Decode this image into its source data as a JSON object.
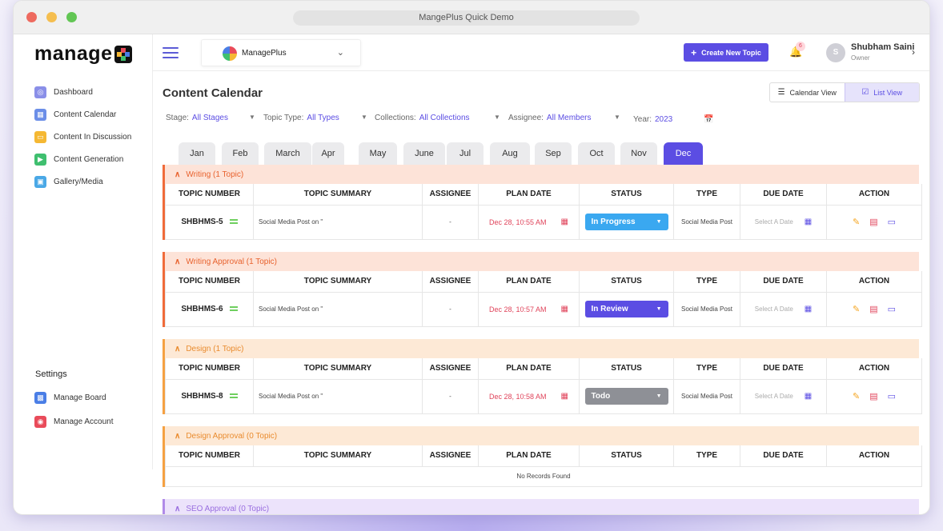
{
  "window_title": "MangePlus Quick Demo",
  "brand": {
    "logo_text": "manage"
  },
  "sidebar": {
    "items": [
      {
        "label": "Dashboard",
        "icon": "dashboard-icon",
        "color": "#8a8fe8"
      },
      {
        "label": "Content Calendar",
        "icon": "calendar-icon",
        "color": "#6b8ee8"
      },
      {
        "label": "Content In Discussion",
        "icon": "chat-icon",
        "color": "#f5b833"
      },
      {
        "label": "Content Generation",
        "icon": "megaphone-icon",
        "color": "#3fbf6f"
      },
      {
        "label": "Gallery/Media",
        "icon": "image-icon",
        "color": "#4aa8e6"
      }
    ],
    "settings_title": "Settings",
    "settings_items": [
      {
        "label": "Manage Board",
        "icon": "board-icon",
        "color": "#4a7ee6"
      },
      {
        "label": "Manage Account",
        "icon": "users-icon",
        "color": "#e94b5a"
      }
    ]
  },
  "topbar": {
    "workspace": "ManagePlus",
    "create_label": "Create New Topic",
    "notification_count": "6",
    "user_initial": "S",
    "user_name": "Shubham Saini",
    "user_role": "Owner"
  },
  "main": {
    "page_title": "Content Calendar",
    "view_calendar": "Calendar View",
    "view_list": "List View",
    "filters": {
      "stage_label": "Stage:",
      "stage_value": "All Stages",
      "type_label": "Topic Type:",
      "type_value": "All Types",
      "collections_label": "Collections:",
      "collections_value": "All Collections",
      "assignee_label": "Assignee:",
      "assignee_value": "All Members",
      "year_label": "Year:",
      "year_value": "2023"
    },
    "months": [
      "Jan",
      "Feb",
      "March",
      "Apr",
      "May",
      "June",
      "Jul",
      "Aug",
      "Sep",
      "Oct",
      "Nov",
      "Dec"
    ],
    "active_month": "Dec",
    "columns": [
      "TOPIC NUMBER",
      "TOPIC SUMMARY",
      "ASSIGNEE",
      "PLAN DATE",
      "STATUS",
      "TYPE",
      "DUE DATE",
      "ACTION"
    ],
    "sections": [
      {
        "title": "Writing (1 Topic)",
        "accent": "#f06b3a",
        "head_bg": "#fde3d8",
        "head_color": "#e8622e",
        "rows": [
          {
            "number": "SHBHMS-5",
            "summary": "Social Media Post on \"",
            "assignee": "-",
            "plan_date": "Dec 28, 10:55 AM",
            "status": "In Progress",
            "status_color": "#3aa8f0",
            "type": "Social Media Post",
            "due": "Select A Date"
          }
        ]
      },
      {
        "title": "Writing Approval (1 Topic)",
        "accent": "#f06b3a",
        "head_bg": "#fde3d8",
        "head_color": "#e8622e",
        "rows": [
          {
            "number": "SHBHMS-6",
            "summary": "Social Media Post on \"",
            "assignee": "-",
            "plan_date": "Dec 28, 10:57 AM",
            "status": "In Review",
            "status_color": "#5b4de3",
            "type": "Social Media Post",
            "due": "Select A Date"
          }
        ]
      },
      {
        "title": "Design (1 Topic)",
        "accent": "#f5a142",
        "head_bg": "#fde9d6",
        "head_color": "#e98b2e",
        "rows": [
          {
            "number": "SHBHMS-8",
            "summary": "Social Media Post on \"",
            "assignee": "-",
            "plan_date": "Dec 28, 10:58 AM",
            "status": "Todo",
            "status_color": "#8e9096",
            "type": "Social Media Post",
            "due": "Select A Date"
          }
        ]
      },
      {
        "title": "Design Approval (0 Topic)",
        "accent": "#f5a142",
        "head_bg": "#fde9d6",
        "head_color": "#e98b2e",
        "rows": [],
        "empty_text": "No Records Found"
      },
      {
        "title": "SEO Approval (0 Topic)",
        "accent": "#b08be8",
        "head_bg": "#ece3fb",
        "head_color": "#9a6fe0",
        "rows": []
      }
    ]
  },
  "colors": {
    "accent": "#5b4de3",
    "danger": "#e0445b",
    "edit": "#f5a623"
  }
}
